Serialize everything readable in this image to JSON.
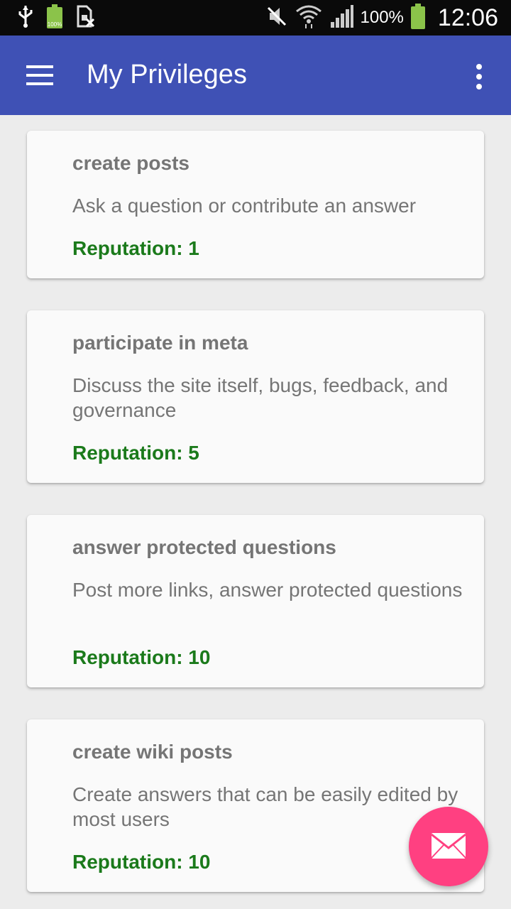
{
  "status_bar": {
    "battery_small_label": "100%",
    "battery_percent": "100%",
    "time": "12:06",
    "icons": [
      "usb-icon",
      "battery-icon",
      "sim-off-icon",
      "mute-icon",
      "wifi-icon",
      "signal-icon",
      "battery-icon"
    ]
  },
  "app_bar": {
    "title": "My Privileges",
    "color": "#3f51b5",
    "menu_icon": "hamburger-menu-icon",
    "overflow_icon": "more-vert-icon"
  },
  "privileges": [
    {
      "title": "create posts",
      "description": "Ask a question or contribute an answer",
      "reputation": "Reputation: 1"
    },
    {
      "title": "participate in meta",
      "description": "Discuss the site itself,  bugs, feedback, and governance",
      "reputation": "Reputation: 5"
    },
    {
      "title": "answer protected questions",
      "description": "Post more links, answer protected questions",
      "reputation": "Reputation: 10"
    },
    {
      "title": "create wiki posts",
      "description": "Create answers that can be easily edited by most users",
      "reputation": "Reputation: 10"
    }
  ],
  "fab": {
    "icon": "mail-icon",
    "color": "#ff4081"
  },
  "colors": {
    "reputation_text": "#1b7a1b",
    "card_text": "#757575",
    "battery": "#8bc34a"
  }
}
